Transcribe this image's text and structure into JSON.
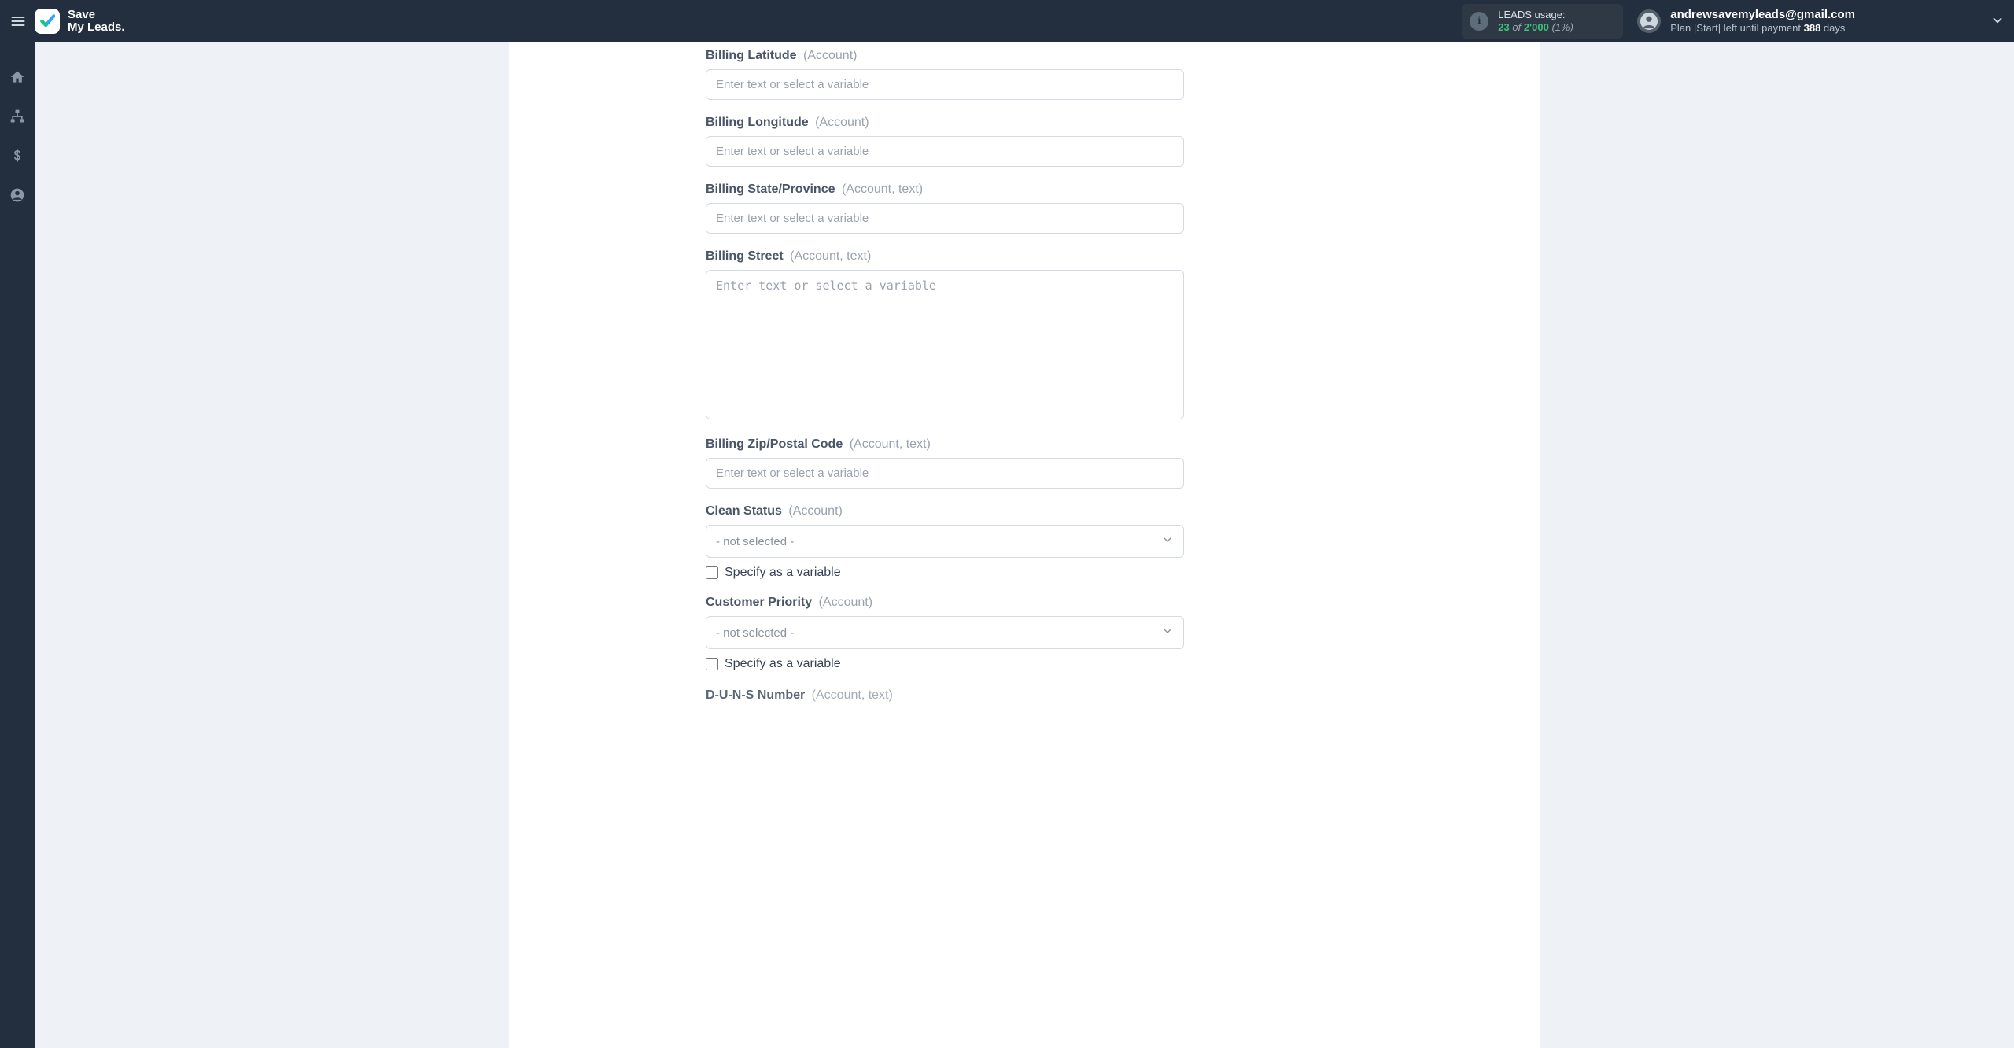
{
  "header": {
    "brand_line1": "Save",
    "brand_line2": "My Leads",
    "usage": {
      "title": "LEADS usage:",
      "used": "23",
      "of": "of",
      "total": "2'000",
      "percent": "(1%)"
    },
    "account": {
      "email": "andrewsavemyleads@gmail.com",
      "plan_prefix": "Plan |Start| left until payment ",
      "plan_days": "388",
      "plan_suffix": " days"
    }
  },
  "sidebar": {
    "items": [
      {
        "name": "home"
      },
      {
        "name": "connections"
      },
      {
        "name": "billing"
      },
      {
        "name": "account"
      }
    ]
  },
  "form": {
    "placeholder": "Enter text or select a variable",
    "not_selected": "- not selected -",
    "specify_var": "Specify as a variable",
    "fields": {
      "billing_latitude": {
        "label": "Billing Latitude",
        "hint": "(Account)"
      },
      "billing_longitude": {
        "label": "Billing Longitude",
        "hint": "(Account)"
      },
      "billing_state": {
        "label": "Billing State/Province",
        "hint": "(Account, text)"
      },
      "billing_street": {
        "label": "Billing Street",
        "hint": "(Account, text)"
      },
      "billing_zip": {
        "label": "Billing Zip/Postal Code",
        "hint": "(Account, text)"
      },
      "clean_status": {
        "label": "Clean Status",
        "hint": "(Account)"
      },
      "customer_priority": {
        "label": "Customer Priority",
        "hint": "(Account)"
      },
      "duns_number": {
        "label": "D-U-N-S Number",
        "hint": "(Account, text)"
      }
    }
  }
}
